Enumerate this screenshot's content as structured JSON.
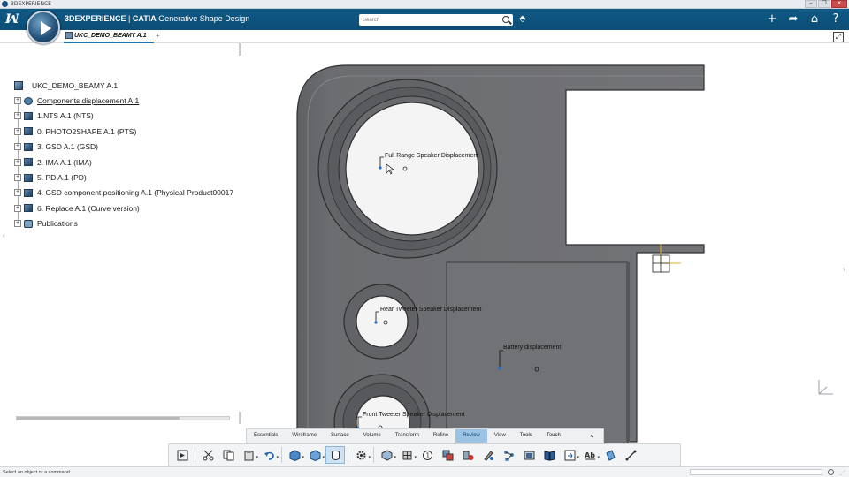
{
  "window": {
    "title": "3DEXPERIENCE",
    "minimize": "–",
    "maximize": "❐",
    "close": "✕"
  },
  "header": {
    "brand": "3DEXPERIENCE",
    "separator": " | ",
    "product": "CATIA",
    "app": " Generative Shape Design",
    "search_placeholder": "Search",
    "icons": {
      "add": "+",
      "share": "➦",
      "home": "⌂",
      "help": "?"
    }
  },
  "tabs": [
    {
      "label": "UKC_DEMO_BEAMY A.1"
    }
  ],
  "tab_add": "+",
  "tree": {
    "root": "UKC_DEMO_BEAMY A.1",
    "items": [
      {
        "label": "Components displacement A.1",
        "icon": "gear-icon"
      },
      {
        "label": "1.NTS A.1 (NTS)",
        "icon": "part-icon"
      },
      {
        "label": "0. PHOTO2SHAPE A.1 (PTS)",
        "icon": "part-icon"
      },
      {
        "label": "3. GSD A.1 (GSD)",
        "icon": "part-icon"
      },
      {
        "label": "2. IMA A.1 (IMA)",
        "icon": "part-icon"
      },
      {
        "label": "5. PD A.1 (PD)",
        "icon": "part-icon"
      },
      {
        "label": "4. GSD component positioning A.1 (Physical Product00017",
        "icon": "part-icon"
      },
      {
        "label": "6. Replace A.1 (Curve version)",
        "icon": "part-icon"
      },
      {
        "label": "Publications",
        "icon": "publications-icon"
      }
    ],
    "expander": "+"
  },
  "callouts": {
    "full_range": "Full Range Speaker Displacement",
    "rear_tweeter": "Rear Tweeter Speaker Displacement",
    "battery": "Battery displacement",
    "front_tweeter": "Front Tweeter Speaker Displacement"
  },
  "action_bar": {
    "tabs": [
      "Essentials",
      "Wireframe",
      "Surface",
      "Volume",
      "Transform",
      "Refine",
      "Review",
      "View",
      "Tools",
      "Touch"
    ],
    "active": "Review",
    "collapse": "⌄"
  },
  "status": {
    "text": "Select an object or a command"
  },
  "colors": {
    "header": "#0b4d75",
    "accent": "#1b76b0",
    "model": "#6f7073",
    "active_tab": "#9cc3e4"
  }
}
